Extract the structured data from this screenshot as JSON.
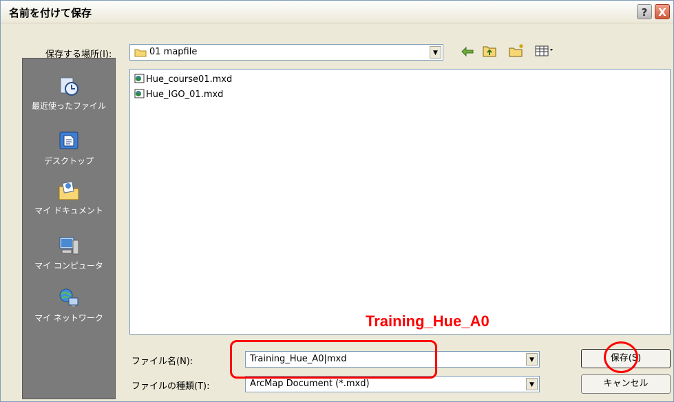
{
  "window": {
    "title": "名前を付けて保存",
    "help_glyph": "?",
    "close_glyph": "X"
  },
  "location": {
    "label": "保存する場所(I):",
    "current_folder": "01 mapfile"
  },
  "places": [
    {
      "label": "最近使ったファイル",
      "icon": "recent-files-icon"
    },
    {
      "label": "デスクトップ",
      "icon": "desktop-icon"
    },
    {
      "label": "マイ ドキュメント",
      "icon": "my-documents-icon"
    },
    {
      "label": "マイ コンピュータ",
      "icon": "my-computer-icon"
    },
    {
      "label": "マイ ネットワーク",
      "icon": "my-network-icon"
    }
  ],
  "files": [
    {
      "name": "Hue_course01.mxd",
      "icon": "arcmap-document-icon"
    },
    {
      "name": "Hue_IGO_01.mxd",
      "icon": "arcmap-document-icon"
    }
  ],
  "filename": {
    "label": "ファイル名(N):",
    "value": "Training_Hue_A0|mxd"
  },
  "filetype": {
    "label": "ファイルの種類(T):",
    "value": "ArcMap Document (*.mxd)"
  },
  "buttons": {
    "save": "保存(S)",
    "cancel": "キャンセル"
  },
  "annotation": {
    "text": "Training_Hue_A0",
    "color": "#ff0000"
  },
  "toolbar_icons": [
    "back-arrow-icon",
    "up-folder-icon",
    "new-folder-icon",
    "view-menu-icon"
  ]
}
